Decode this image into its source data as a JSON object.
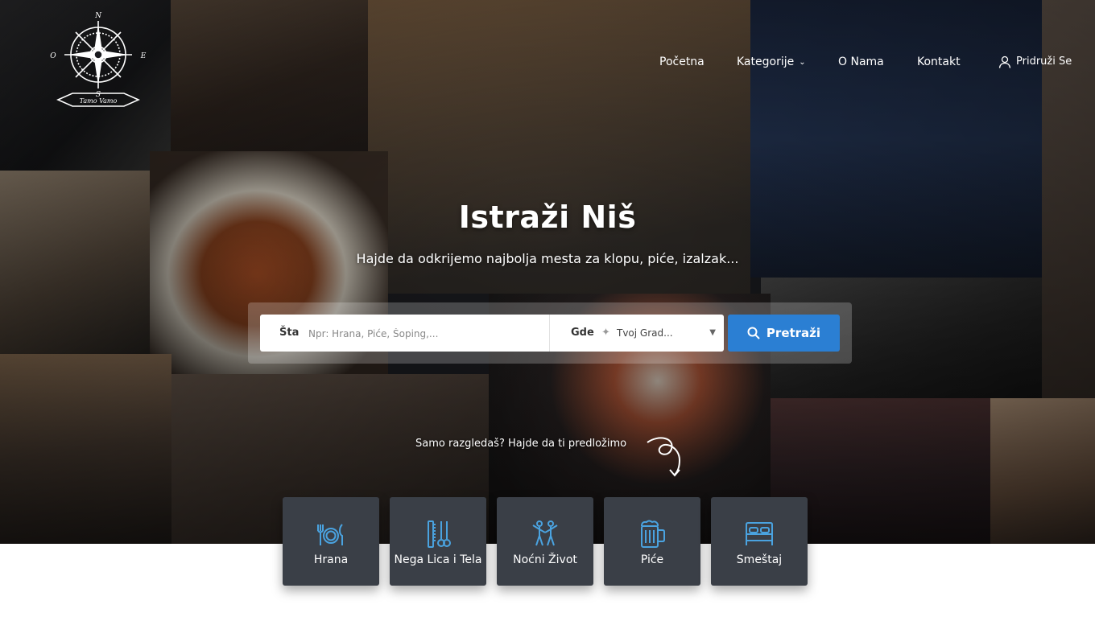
{
  "brand": {
    "logo_text": "Tamo Vamo",
    "compass_letters": [
      "N",
      "E",
      "S",
      "O"
    ]
  },
  "nav": {
    "items": [
      {
        "label": "Početna"
      },
      {
        "label": "Kategorije",
        "has_dropdown": true
      },
      {
        "label": "O Nama"
      },
      {
        "label": "Kontakt"
      }
    ],
    "join_label": "Pridruži Se"
  },
  "hero": {
    "title": "Istraži Niš",
    "subtitle": "Hajde da odkrijemo najbolja mesta za klopu, piće, izalzak..."
  },
  "search": {
    "what_label": "Šta",
    "what_placeholder": "Npr: Hrana, Piće, Šoping,...",
    "where_label": "Gde",
    "where_value": "Tvoj Grad...",
    "button_label": "Pretraži"
  },
  "suggest_text": "Samo razgledaš? Hajde da ti predložimo",
  "categories": [
    {
      "label": "Hrana",
      "icon": "utensils-icon"
    },
    {
      "label": "Nega Lica i Tela",
      "icon": "comb-scissors-icon"
    },
    {
      "label": "Noćni Život",
      "icon": "dancing-people-icon"
    },
    {
      "label": "Piće",
      "icon": "beer-mug-icon"
    },
    {
      "label": "Smeštaj",
      "icon": "bed-icon"
    }
  ],
  "colors": {
    "accent": "#2b7fd3",
    "card_bg": "#3a3f47",
    "icon": "#4aa3e0"
  }
}
